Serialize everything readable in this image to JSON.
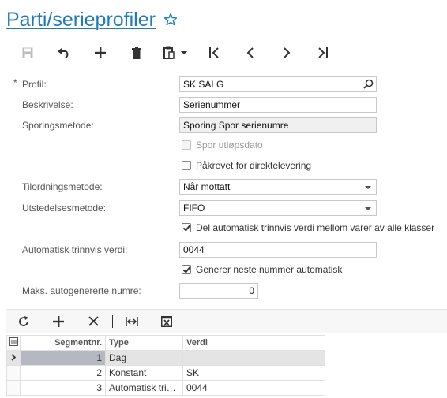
{
  "header": {
    "title": "Parti/serieprofiler"
  },
  "colors": {
    "accent": "#1f7bbf",
    "selected_cell": "#b5b8c0"
  },
  "toolbar": {
    "buttons": [
      "save-icon",
      "undo-icon",
      "add-icon",
      "delete-icon",
      "clipboard-icon",
      "first-icon",
      "previous-icon",
      "next-icon",
      "last-icon"
    ]
  },
  "form": {
    "profil": {
      "label": "Profil:",
      "required_mark": "*",
      "value": "SK SALG"
    },
    "beskrivelse": {
      "label": "Beskrivelse:",
      "value": "Serienummer"
    },
    "sporingsmetode": {
      "label": "Sporingsmetode:",
      "value": "Sporing Spor serienumre"
    },
    "spor_utlopsdato": {
      "label": "Spor utløpsdato",
      "checked": false,
      "disabled": true
    },
    "pakrevet": {
      "label": "Påkrevet for direktelevering",
      "checked": false
    },
    "tilordningsmetode": {
      "label": "Tilordningsmetode:",
      "value": "Når mottatt"
    },
    "utstedelsesmetode": {
      "label": "Utstedelsesmetode:",
      "value": "FIFO"
    },
    "del_automatisk": {
      "label": "Del automatisk trinnvis verdi mellom varer av alle klasser",
      "checked": true
    },
    "automatisk_trinnvis": {
      "label": "Automatisk trinnvis verdi:",
      "value": "0044"
    },
    "generer_neste": {
      "label": "Generer neste nummer automatisk",
      "checked": true
    },
    "maks_autogenererte": {
      "label": "Maks. autogenererte numre:",
      "value": "0"
    }
  },
  "grid": {
    "columns": [
      "Segmentnr.",
      "Type",
      "Verdi"
    ],
    "rows": [
      {
        "segment": "1",
        "type": "Dag",
        "value": ""
      },
      {
        "segment": "2",
        "type": "Konstant",
        "value": "SK"
      },
      {
        "segment": "3",
        "type": "Automatisk tri…",
        "value": "0044"
      }
    ]
  }
}
